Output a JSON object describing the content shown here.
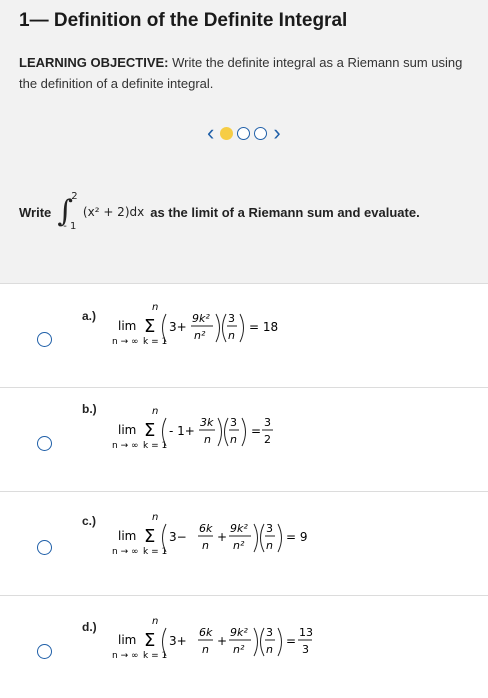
{
  "title": "1— Definition of the Definite Integral",
  "objective": {
    "label": "LEARNING OBJECTIVE:",
    "text": "Write the definite integral as a Riemann sum using the definition of a definite integral."
  },
  "pager": {
    "total": 3,
    "active_index": 0,
    "prev_icon": "chevron-left-icon",
    "next_icon": "chevron-right-icon"
  },
  "prompt": {
    "before": "Write",
    "integral": {
      "upper": "2",
      "lower": "- 1",
      "integrand": "(x² + 2)dx"
    },
    "after": "as the limit of a Riemann sum and evaluate."
  },
  "options": [
    {
      "label": "a.)",
      "lim": "lim",
      "sub": "n → ∞",
      "sum_top": "n",
      "sum_bottom": "k = 1",
      "inner": "3 + 9k²/n²",
      "factor": "3/n",
      "result": "= 18"
    },
    {
      "label": "b.)",
      "lim": "lim",
      "sub": "n → ∞",
      "sum_top": "n",
      "sum_bottom": "k = 1",
      "inner": "- 1 + 3k/n",
      "factor": "3/n",
      "result": "= 3/2"
    },
    {
      "label": "c.)",
      "lim": "lim",
      "sub": "n → ∞",
      "sum_top": "n",
      "sum_bottom": "k = 1",
      "inner": "3 − 6k/n + 9k²/n²",
      "factor": "3/n",
      "result": "= 9"
    },
    {
      "label": "d.)",
      "lim": "lim",
      "sub": "n → ∞",
      "sum_top": "n",
      "sum_bottom": "k = 1",
      "inner": "3 + 6k/n + 9k²/n²",
      "factor": "3/n",
      "result": "= 13/3"
    }
  ]
}
